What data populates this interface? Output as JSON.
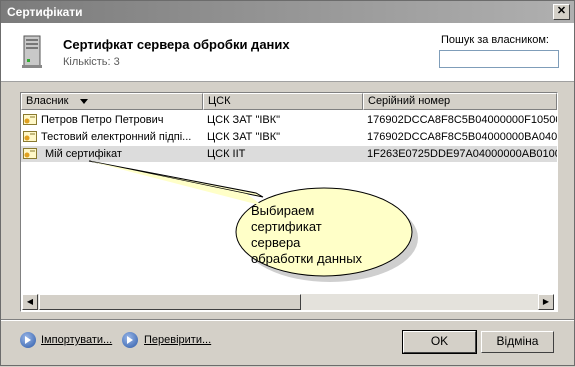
{
  "window": {
    "title": "Сертифікати",
    "close_glyph": "✕"
  },
  "header": {
    "title": "Сертифкат сервера обробки даних",
    "count": "Кількість: 3",
    "search_label": "Пошук за власником:",
    "search_value": ""
  },
  "table": {
    "columns": [
      "Власник",
      "ЦСК",
      "Серійний номер"
    ],
    "rows": [
      {
        "owner": "Петров Петро Петрович",
        "csk": "ЦСК ЗАТ \"ІВК\"",
        "serial": "176902DCCA8F8C5B04000000F10500",
        "selected": false
      },
      {
        "owner": "Тестовий електронний підпі...",
        "csk": "ЦСК ЗАТ \"ІВК\"",
        "serial": "176902DCCA8F8C5B04000000BA0400",
        "selected": false
      },
      {
        "owner": "Мій сертифікат",
        "csk": "ЦСК ІІТ",
        "serial": "1F263E0725DDE97A04000000AB0100",
        "selected": true
      }
    ]
  },
  "callout": {
    "lines": [
      "Выбираем",
      "сертификат",
      "сервера",
      "обработки данных"
    ]
  },
  "footer": {
    "import_label": "Імпортувати...",
    "verify_label": "Перевірити...",
    "ok_label": "OK",
    "cancel_label": "Відміна"
  }
}
